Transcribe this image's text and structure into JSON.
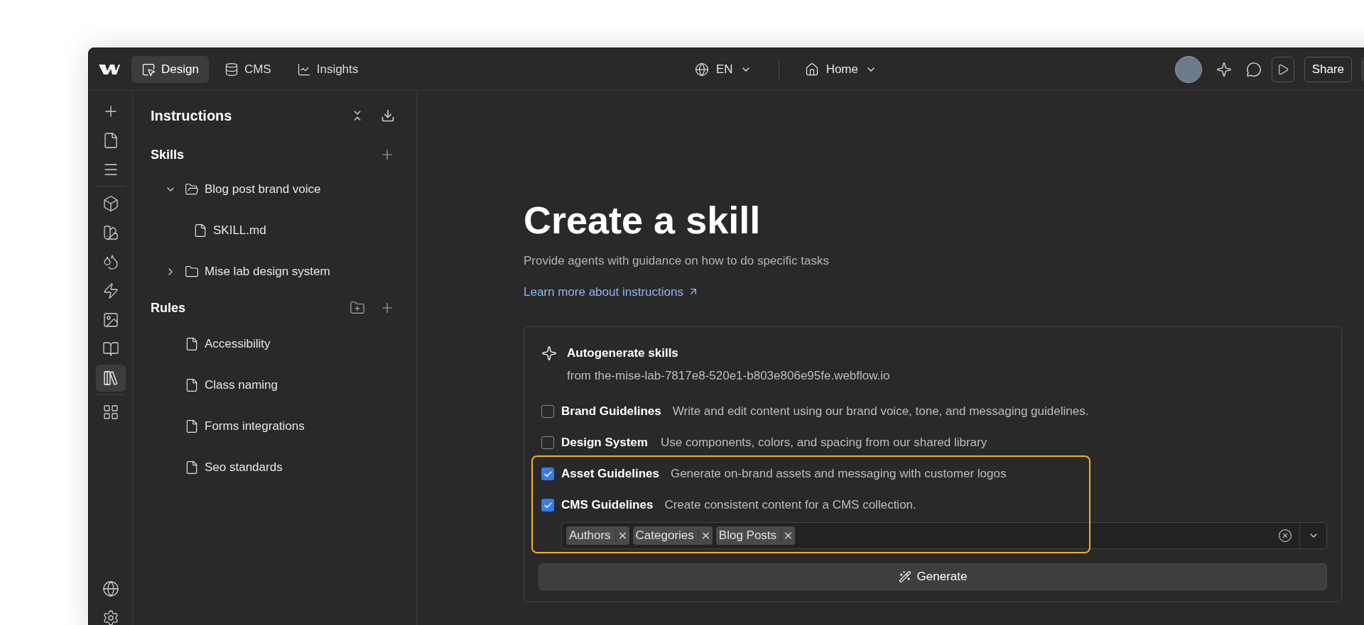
{
  "topbar": {
    "tabs": [
      {
        "label": "Design",
        "kind": "design",
        "selected": true
      },
      {
        "label": "CMS",
        "kind": "cms",
        "selected": false
      },
      {
        "label": "Insights",
        "kind": "insights",
        "selected": false
      }
    ],
    "language": "EN",
    "page": "Home",
    "share": "Share"
  },
  "rail": {
    "groups": [
      [
        {
          "kind": "add",
          "selected": false
        },
        {
          "kind": "page",
          "selected": false
        },
        {
          "kind": "navigator",
          "selected": false
        }
      ],
      [
        {
          "kind": "components",
          "selected": false
        },
        {
          "kind": "styles",
          "selected": false
        },
        {
          "kind": "variables",
          "selected": false
        },
        {
          "kind": "interactions",
          "selected": false
        },
        {
          "kind": "assets",
          "selected": false
        },
        {
          "kind": "docs",
          "selected": false
        },
        {
          "kind": "library",
          "selected": true
        }
      ],
      [
        {
          "kind": "apps",
          "selected": false
        }
      ]
    ],
    "bottom": [
      {
        "kind": "locale",
        "selected": false
      },
      {
        "kind": "settings",
        "selected": false
      }
    ]
  },
  "panel": {
    "title": "Instructions",
    "skills": {
      "title": "Skills",
      "items": [
        {
          "label": "Blog post brand voice",
          "kind": "folder",
          "expanded": true,
          "children": [
            {
              "label": "SKILL.md",
              "kind": "file"
            }
          ]
        },
        {
          "label": "Mise lab design system",
          "kind": "folder",
          "expanded": false
        }
      ]
    },
    "rules": {
      "title": "Rules",
      "items": [
        {
          "label": "Accessibility",
          "kind": "file"
        },
        {
          "label": "Class naming",
          "kind": "file"
        },
        {
          "label": "Forms integrations",
          "kind": "file"
        },
        {
          "label": "Seo standards",
          "kind": "file"
        }
      ]
    }
  },
  "main": {
    "heading": "Create a skill",
    "subtitle": "Provide agents with guidance on how to do specific tasks",
    "link": "Learn more about instructions",
    "card": {
      "title": "Autogenerate skills",
      "source": "from the-mise-lab-7817e8-520e1-b803e806e95fe.webflow.io",
      "options": [
        {
          "name": "Brand Guidelines",
          "description": "Write and edit content using our brand voice, tone, and messaging guidelines.",
          "checked": false,
          "highlighted": false
        },
        {
          "name": "Design System",
          "description": "Use components, colors, and spacing from our shared library",
          "checked": false,
          "highlighted": false
        },
        {
          "name": "Asset Guidelines",
          "description": "Generate on-brand assets and messaging with customer logos",
          "checked": true,
          "highlighted": true
        },
        {
          "name": "CMS Guidelines",
          "description": "Create consistent content for a CMS collection.",
          "checked": true,
          "highlighted": true,
          "tags": [
            "Authors",
            "Categories",
            "Blog Posts"
          ]
        }
      ],
      "button": "Generate"
    }
  }
}
